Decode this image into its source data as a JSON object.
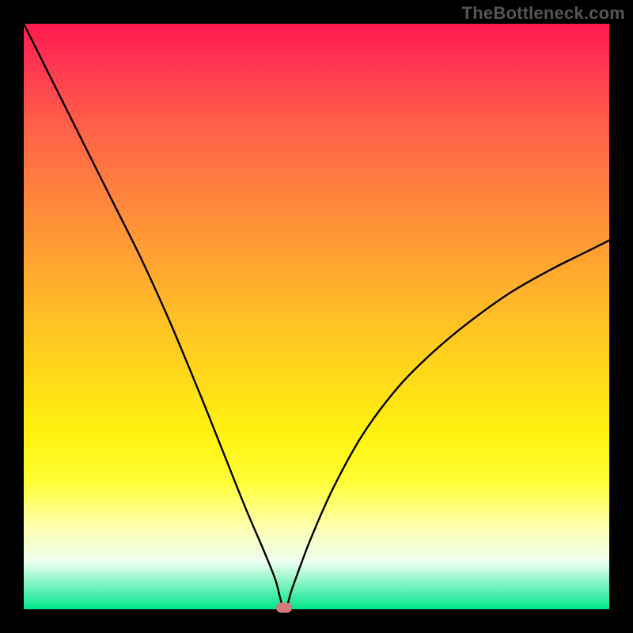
{
  "watermark": "TheBottleneck.com",
  "marker": {
    "x_frac": 0.445,
    "y_frac": 0.997
  },
  "chart_data": {
    "type": "line",
    "title": "",
    "xlabel": "",
    "ylabel": "",
    "xlim": [
      0,
      1
    ],
    "ylim": [
      0,
      1
    ],
    "series": [
      {
        "name": "curve",
        "x": [
          0.0,
          0.05,
          0.1,
          0.15,
          0.2,
          0.25,
          0.3,
          0.34,
          0.38,
          0.41,
          0.43,
          0.445,
          0.46,
          0.49,
          0.53,
          0.58,
          0.64,
          0.7,
          0.76,
          0.83,
          0.9,
          0.96,
          1.0
        ],
        "y": [
          1.0,
          0.9,
          0.8,
          0.7,
          0.6,
          0.49,
          0.37,
          0.27,
          0.17,
          0.1,
          0.05,
          0.0,
          0.04,
          0.12,
          0.21,
          0.3,
          0.38,
          0.44,
          0.49,
          0.54,
          0.58,
          0.61,
          0.63
        ]
      }
    ],
    "annotations": [
      {
        "type": "marker",
        "x": 0.445,
        "y": 0.003,
        "color": "#d47a7a"
      }
    ]
  }
}
